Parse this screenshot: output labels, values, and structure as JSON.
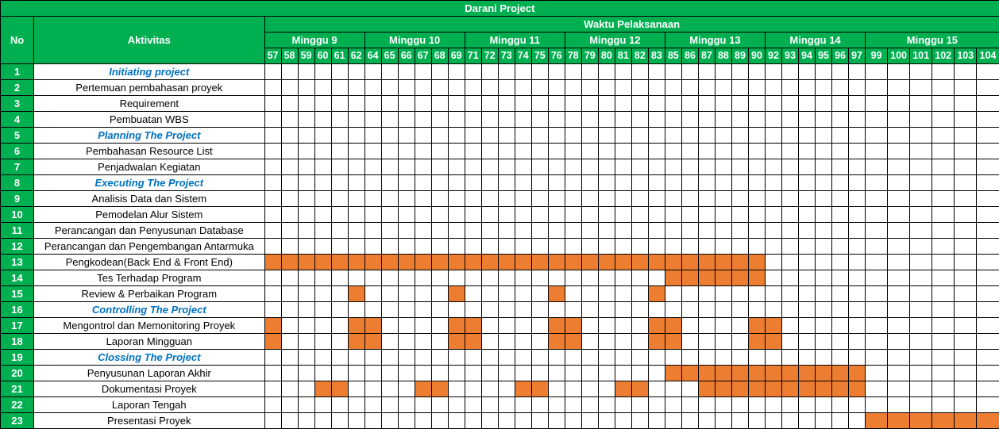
{
  "title": "Darani Project",
  "headers": {
    "no": "No",
    "activity": "Aktivitas",
    "time": "Waktu Pelaksanaan"
  },
  "colors": {
    "header_green": "#00b050",
    "phase_blue": "#0070c0",
    "bar_orange": "#ed7d31"
  },
  "chart_data": {
    "type": "table",
    "weeks": [
      {
        "label": "Minggu 9",
        "days": [
          57,
          58,
          59,
          60,
          61,
          62
        ]
      },
      {
        "label": "Minggu 10",
        "days": [
          64,
          65,
          66,
          67,
          68,
          69
        ]
      },
      {
        "label": "Minggu 11",
        "days": [
          71,
          72,
          73,
          74,
          75,
          76
        ]
      },
      {
        "label": "Minggu 12",
        "days": [
          78,
          79,
          80,
          81,
          82,
          83
        ]
      },
      {
        "label": "Minggu 13",
        "days": [
          85,
          86,
          87,
          88,
          89,
          90
        ]
      },
      {
        "label": "Minggu 14",
        "days": [
          92,
          93,
          94,
          95,
          96,
          97
        ]
      },
      {
        "label": "Minggu 15",
        "days": [
          99,
          100,
          101,
          102,
          103,
          104
        ]
      }
    ],
    "tasks": [
      {
        "no": "1",
        "name": "Initiating project",
        "phase": true,
        "days": []
      },
      {
        "no": "2",
        "name": "Pertemuan pembahasan proyek",
        "phase": false,
        "days": []
      },
      {
        "no": "3",
        "name": "Requirement",
        "phase": false,
        "days": []
      },
      {
        "no": "4",
        "name": "Pembuatan WBS",
        "phase": false,
        "days": []
      },
      {
        "no": "5",
        "name": "Planning The Project",
        "phase": true,
        "days": []
      },
      {
        "no": "6",
        "name": "Pembahasan Resource List",
        "phase": false,
        "days": []
      },
      {
        "no": "7",
        "name": "Penjadwalan Kegiatan",
        "phase": false,
        "days": []
      },
      {
        "no": "8",
        "name": "Executing The Project",
        "phase": true,
        "days": []
      },
      {
        "no": "9",
        "name": "Analisis Data dan Sistem",
        "phase": false,
        "days": []
      },
      {
        "no": "10",
        "name": "Pemodelan Alur Sistem",
        "phase": false,
        "days": []
      },
      {
        "no": "11",
        "name": "Perancangan dan Penyusunan Database",
        "phase": false,
        "days": []
      },
      {
        "no": "12",
        "name": "Perancangan dan Pengembangan Antarmuka",
        "phase": false,
        "days": []
      },
      {
        "no": "13",
        "name": "Pengkodean(Back End & Front End)",
        "phase": false,
        "days": [
          57,
          58,
          59,
          60,
          61,
          62,
          64,
          65,
          66,
          67,
          68,
          69,
          71,
          72,
          73,
          74,
          75,
          76,
          78,
          79,
          80,
          81,
          82,
          83,
          85,
          86,
          87,
          88,
          89,
          90
        ]
      },
      {
        "no": "14",
        "name": "Tes Terhadap Program",
        "phase": false,
        "days": [
          85,
          86,
          87,
          88,
          89,
          90
        ]
      },
      {
        "no": "15",
        "name": "Review & Perbaikan Program",
        "phase": false,
        "days": [
          62,
          69,
          76,
          83
        ]
      },
      {
        "no": "16",
        "name": "Controlling The Project",
        "phase": true,
        "days": []
      },
      {
        "no": "17",
        "name": "Mengontrol dan Memonitoring Proyek",
        "phase": false,
        "days": [
          57,
          62,
          64,
          69,
          71,
          76,
          78,
          83,
          85,
          90,
          92
        ]
      },
      {
        "no": "18",
        "name": "Laporan Mingguan",
        "phase": false,
        "days": [
          57,
          62,
          64,
          69,
          71,
          76,
          78,
          83,
          85,
          90,
          92
        ]
      },
      {
        "no": "19",
        "name": "Clossing The Project",
        "phase": true,
        "days": []
      },
      {
        "no": "20",
        "name": "Penyusunan Laporan Akhir",
        "phase": false,
        "days": [
          85,
          86,
          87,
          88,
          89,
          90,
          92,
          93,
          94,
          95,
          96,
          97
        ]
      },
      {
        "no": "21",
        "name": "Dokumentasi Proyek",
        "phase": false,
        "days": [
          60,
          61,
          67,
          68,
          74,
          75,
          81,
          82,
          87,
          88,
          89,
          90,
          92,
          93,
          94,
          95,
          96,
          97
        ]
      },
      {
        "no": "22",
        "name": "Laporan Tengah",
        "phase": false,
        "days": []
      },
      {
        "no": "23",
        "name": "Presentasi Proyek",
        "phase": false,
        "days": [
          99,
          100,
          101,
          102,
          103,
          104
        ]
      }
    ]
  }
}
